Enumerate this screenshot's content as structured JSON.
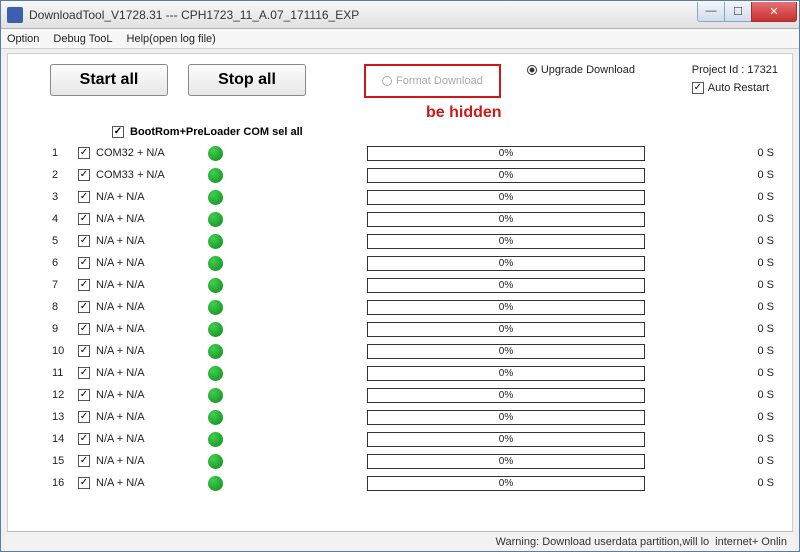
{
  "window": {
    "title": "DownloadTool_V1728.31 --- CPH1723_11_A.07_171116_EXP"
  },
  "menu": {
    "option": "Option",
    "debug": "Debug TooL",
    "help": "Help(open log file)"
  },
  "toolbar": {
    "start": "Start all",
    "stop": "Stop all",
    "format_download": "Format Download",
    "upgrade_download": "Upgrade Download",
    "project_id_label": "Project Id :",
    "project_id_value": "17321",
    "auto_restart": "Auto Restart"
  },
  "annotation": "be hidden",
  "select_all_label": "BootRom+PreLoader COM sel all",
  "rows": [
    {
      "idx": "1",
      "label": "COM32 + N/A",
      "progress": "0%",
      "time": "0 S"
    },
    {
      "idx": "2",
      "label": "COM33 + N/A",
      "progress": "0%",
      "time": "0 S"
    },
    {
      "idx": "3",
      "label": "N/A + N/A",
      "progress": "0%",
      "time": "0 S"
    },
    {
      "idx": "4",
      "label": "N/A + N/A",
      "progress": "0%",
      "time": "0 S"
    },
    {
      "idx": "5",
      "label": "N/A + N/A",
      "progress": "0%",
      "time": "0 S"
    },
    {
      "idx": "6",
      "label": "N/A + N/A",
      "progress": "0%",
      "time": "0 S"
    },
    {
      "idx": "7",
      "label": "N/A + N/A",
      "progress": "0%",
      "time": "0 S"
    },
    {
      "idx": "8",
      "label": "N/A + N/A",
      "progress": "0%",
      "time": "0 S"
    },
    {
      "idx": "9",
      "label": "N/A + N/A",
      "progress": "0%",
      "time": "0 S"
    },
    {
      "idx": "10",
      "label": "N/A + N/A",
      "progress": "0%",
      "time": "0 S"
    },
    {
      "idx": "11",
      "label": "N/A + N/A",
      "progress": "0%",
      "time": "0 S"
    },
    {
      "idx": "12",
      "label": "N/A + N/A",
      "progress": "0%",
      "time": "0 S"
    },
    {
      "idx": "13",
      "label": "N/A + N/A",
      "progress": "0%",
      "time": "0 S"
    },
    {
      "idx": "14",
      "label": "N/A + N/A",
      "progress": "0%",
      "time": "0 S"
    },
    {
      "idx": "15",
      "label": "N/A + N/A",
      "progress": "0%",
      "time": "0 S"
    },
    {
      "idx": "16",
      "label": "N/A + N/A",
      "progress": "0%",
      "time": "0 S"
    }
  ],
  "status": {
    "warning": "Warning: Download userdata partition,will lo",
    "network": "internet+ Onlin"
  }
}
